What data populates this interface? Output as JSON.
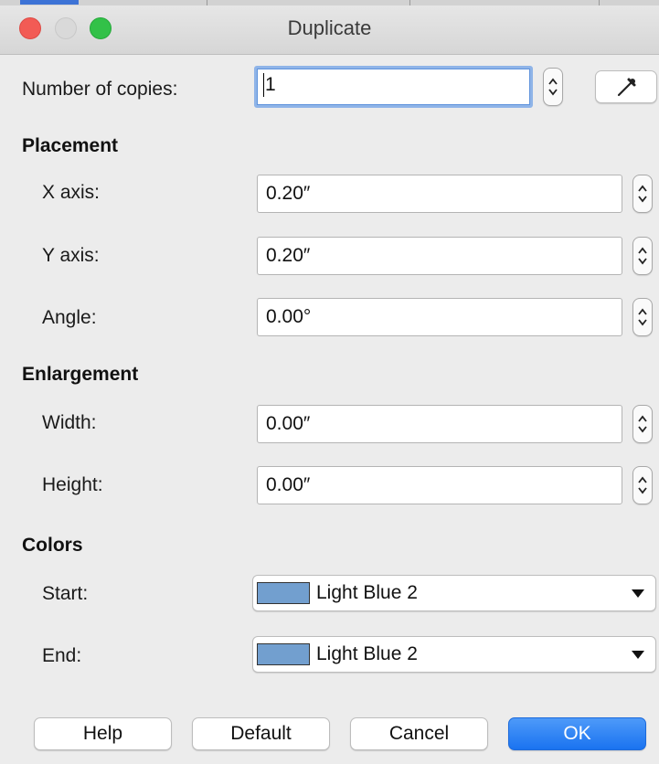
{
  "window": {
    "title": "Duplicate"
  },
  "copies": {
    "label": "Number of copies:",
    "value": "1"
  },
  "placement": {
    "heading": "Placement",
    "x_axis": {
      "label": "X axis:",
      "value": "0.20″"
    },
    "y_axis": {
      "label": "Y axis:",
      "value": "0.20″"
    },
    "angle": {
      "label": "Angle:",
      "value": "0.00°"
    }
  },
  "enlargement": {
    "heading": "Enlargement",
    "width": {
      "label": "Width:",
      "value": "0.00″"
    },
    "height": {
      "label": "Height:",
      "value": "0.00″"
    }
  },
  "colors": {
    "heading": "Colors",
    "start": {
      "label": "Start:",
      "value": "Light Blue 2",
      "swatch": "#729fcf"
    },
    "end": {
      "label": "End:",
      "value": "Light Blue 2",
      "swatch": "#729fcf"
    }
  },
  "buttons": {
    "help": "Help",
    "default": "Default",
    "cancel": "Cancel",
    "ok": "OK"
  },
  "icons": {
    "values_from_selection": "eyedropper-icon",
    "spin": "spin-arrows-icon",
    "dropdown": "triangle-down-icon"
  },
  "accent_colors": {
    "primary_button": "#1a73f0",
    "focus_ring": "#8fb4e8",
    "close": "#f25b55",
    "maximize": "#32c148"
  }
}
